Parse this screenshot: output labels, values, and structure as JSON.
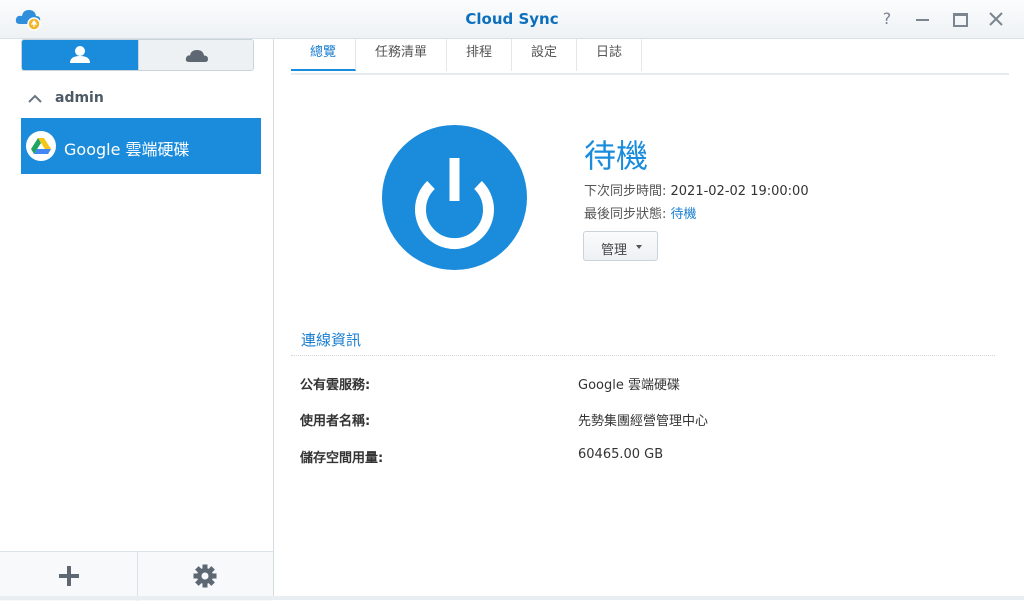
{
  "window": {
    "title": "Cloud Sync",
    "help_glyph": "?"
  },
  "sidebar": {
    "group_label": "admin",
    "item_label": "Google 雲端硬碟"
  },
  "tabs": [
    {
      "label": "總覽"
    },
    {
      "label": "任務清單"
    },
    {
      "label": "排程"
    },
    {
      "label": "設定"
    },
    {
      "label": "日誌"
    }
  ],
  "status": {
    "title": "待機",
    "next_sync_label": "下次同步時間: ",
    "next_sync_value": "2021-02-02 19:00:00",
    "last_status_label": "最後同步狀態: ",
    "last_status_value": "待機",
    "manage_label": "管理"
  },
  "connection": {
    "section_title": "連線資訊",
    "rows": [
      {
        "label": "公有雲服務:",
        "value": "Google 雲端硬碟"
      },
      {
        "label": "使用者名稱:",
        "value": "先勢集團經營管理中心"
      },
      {
        "label": "儲存空間用量:",
        "value": "60465.00 GB"
      }
    ]
  },
  "icons": {
    "app": "cloud-sync-app-icon",
    "user": "user-icon",
    "cloud": "cloud-icon",
    "chevron": "chevron-up-icon",
    "drive": "google-drive-icon",
    "power": "power-icon",
    "add": "plus-icon",
    "settings": "gear-icon"
  },
  "colors": {
    "accent": "#1a8cdb",
    "title": "#0b6fbe"
  }
}
